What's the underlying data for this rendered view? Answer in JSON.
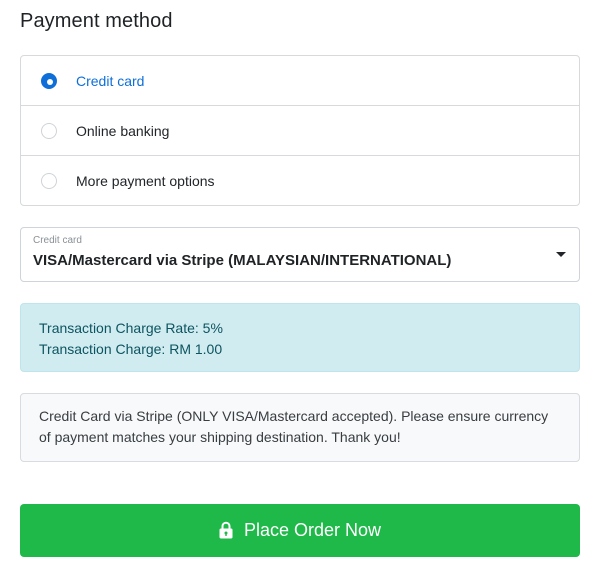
{
  "header": {
    "title": "Payment method"
  },
  "payment_methods": {
    "selected": "credit_card",
    "items": [
      {
        "label": "Credit card",
        "checked": true
      },
      {
        "label": "Online banking",
        "checked": false
      },
      {
        "label": "More payment options",
        "checked": false
      }
    ]
  },
  "card_select": {
    "caption": "Credit card",
    "value": "VISA/Mastercard via Stripe (MALAYSIAN/INTERNATIONAL)"
  },
  "charge_info": {
    "rate_line": "Transaction Charge Rate: 5%",
    "charge_line": "Transaction Charge: RM 1.00"
  },
  "note": {
    "text": "Credit Card via Stripe (ONLY VISA/Mastercard accepted). Please ensure currency of payment matches your shipping destination. Thank you!"
  },
  "order_button": {
    "label": "Place Order Now",
    "icon": "lock-icon"
  },
  "colors": {
    "accent": "#0f6fd8",
    "success": "#1fb94a",
    "info_bg": "#d1ecf1",
    "info_text": "#0c5460"
  }
}
